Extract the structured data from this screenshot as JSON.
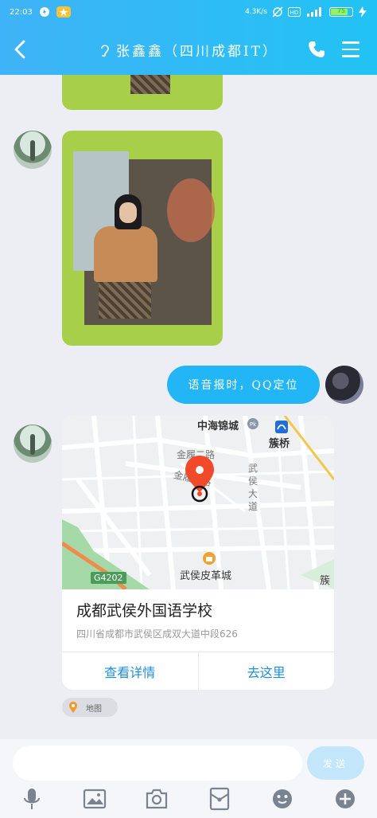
{
  "status": {
    "time": "22:03",
    "net_speed": "4.3K/s",
    "battery": "75"
  },
  "header": {
    "title": "张鑫鑫（四川成都IT）"
  },
  "messages": [
    {
      "type": "image-partial",
      "from": "other"
    },
    {
      "type": "image",
      "from": "other"
    },
    {
      "type": "text",
      "from": "self",
      "text": "语音报时，QQ定位"
    },
    {
      "type": "location",
      "from": "other"
    }
  ],
  "location": {
    "name": "成都武侯外国语学校",
    "address": "四川省成都市武侯区成双大道中段626",
    "view_details": "查看详情",
    "go_here": "去这里",
    "map_labels": {
      "mall": "中海锦城",
      "bridge": "簇桥",
      "road1": "金履二路",
      "road2": "金履二路",
      "avenue": "武侯大道",
      "leather": "武侯皮革城",
      "highway": "G4202",
      "edge": "簇锦"
    }
  },
  "tag": {
    "label": "地图"
  },
  "input": {
    "placeholder": "",
    "send_label": "发送"
  },
  "colors": {
    "accent": "#22b6f6",
    "pin": "#f04a2a"
  }
}
